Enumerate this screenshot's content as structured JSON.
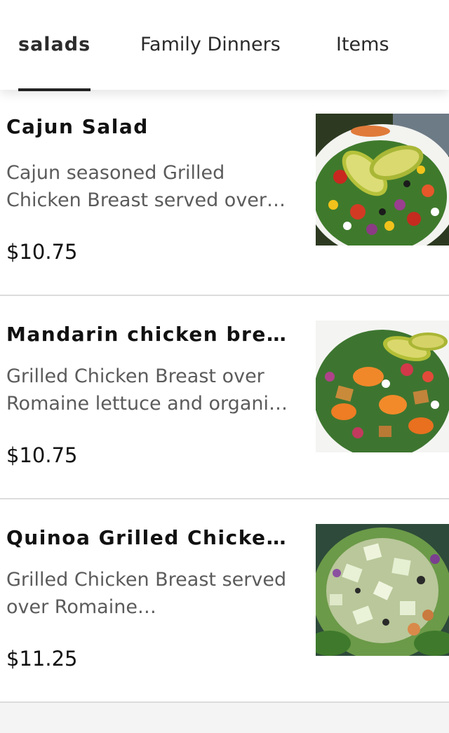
{
  "tabs": [
    {
      "label": "salads",
      "active": true
    },
    {
      "label": "Family Dinners",
      "active": false
    },
    {
      "label": "Items",
      "active": false
    }
  ],
  "menu_items": [
    {
      "name": "Cajun Salad",
      "description": "Cajun seasoned Grilled Chicken Breast served over…",
      "price": "$10.75",
      "image": "cajun-salad-photo"
    },
    {
      "name": "Mandarin chicken brea…",
      "description": "Grilled Chicken Breast over Romaine lettuce and organi…",
      "price": "$10.75",
      "image": "mandarin-chicken-salad-photo"
    },
    {
      "name": "Quinoa Grilled Chicken…",
      "description": "Grilled Chicken Breast served over Romaine…",
      "price": "$11.25",
      "image": "quinoa-chicken-salad-photo"
    }
  ],
  "colors": {
    "background": "#f5f4f4",
    "card": "#ffffff",
    "text_primary": "#111111",
    "text_secondary": "#5b5b5b",
    "tab_indicator": "#222222"
  }
}
